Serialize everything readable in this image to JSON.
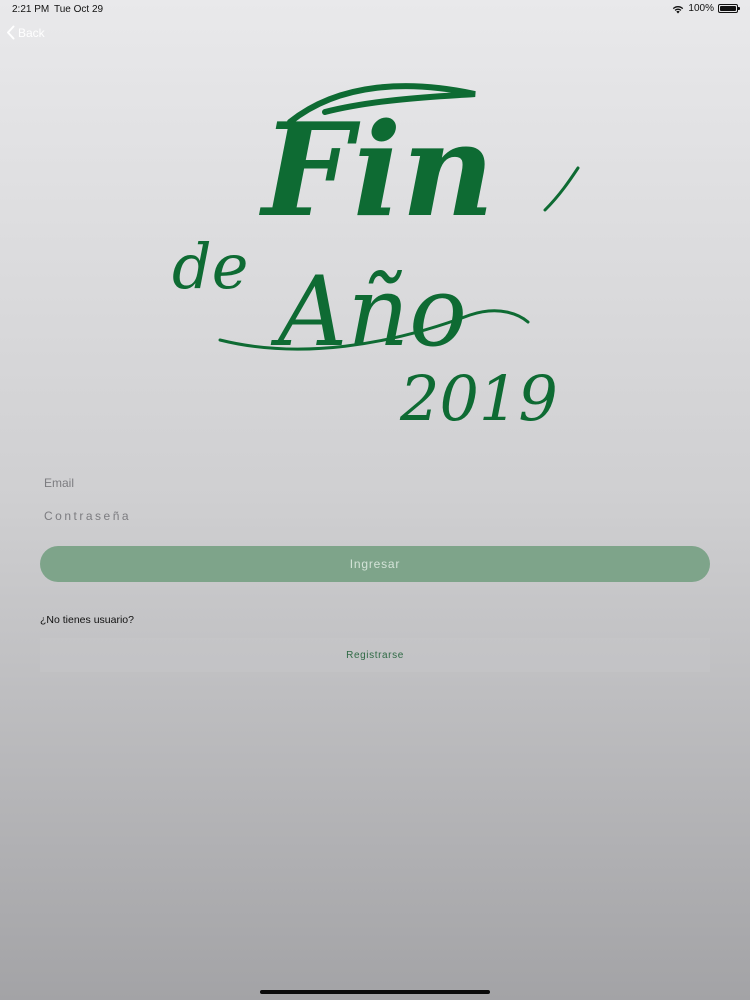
{
  "status_bar": {
    "time": "2:21 PM",
    "date": "Tue Oct 29",
    "battery": "100%",
    "icons": [
      "wifi-icon",
      "battery-icon"
    ]
  },
  "nav": {
    "back_label": "Back",
    "back_icon": "chevron-left-icon"
  },
  "logo": {
    "line1": "Fin",
    "line2a": "de",
    "line2b": "Año",
    "line3": "2019",
    "color": "#0e6b33"
  },
  "form": {
    "email_placeholder": "Email",
    "email_value": "",
    "password_placeholder": "Contraseña",
    "password_value": "",
    "login_label": "Ingresar",
    "no_user_label": "¿No tienes usuario?",
    "register_label": "Registrarse"
  },
  "colors": {
    "brand_green": "#0e6b33",
    "login_button_bg": "#7ea48a",
    "login_button_text": "#d4e3d8",
    "register_text": "#2f6a45"
  }
}
